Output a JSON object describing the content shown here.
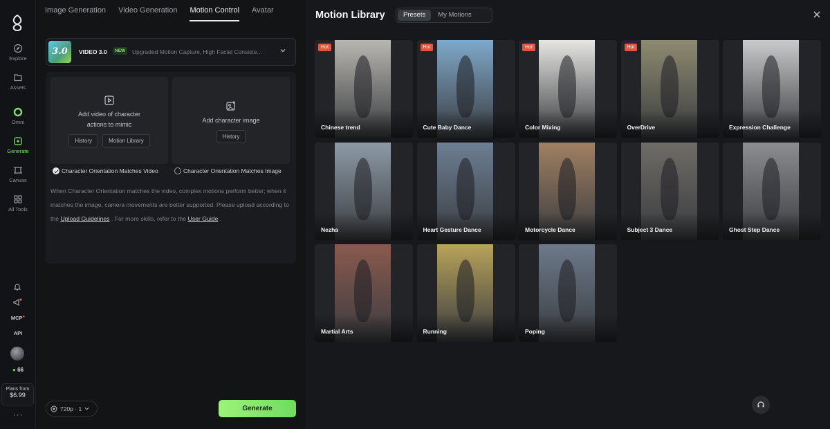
{
  "rail": {
    "items": [
      {
        "label": "Explore",
        "icon": "compass-icon"
      },
      {
        "label": "Assets",
        "icon": "folder-icon"
      },
      {
        "label": "Omni",
        "icon": "omni-icon"
      },
      {
        "label": "Generate",
        "icon": "generate-icon"
      },
      {
        "label": "Canvas",
        "icon": "canvas-icon"
      },
      {
        "label": "All Tools",
        "icon": "grid-icon"
      }
    ],
    "mcp_label": "MCP",
    "api_label": "API",
    "credits": "66",
    "plans_label": "Plans from",
    "plans_price": "$6.99",
    "more": "···"
  },
  "tabs": [
    "Image Generation",
    "Video Generation",
    "Motion Control",
    "Avatar"
  ],
  "active_tab": "Motion Control",
  "model": {
    "badge": "3.0",
    "name": "VIDEO 3.0",
    "tag": "NEW",
    "description": "Upgraded Motion Capture, High Facial Consiste..."
  },
  "upload": {
    "video_label_1": "Add video of character",
    "video_label_2": "actions to mimic",
    "history": "History",
    "motion_library": "Motion Library",
    "image_label": "Add character image",
    "image_history": "History"
  },
  "orientation": {
    "video": "Character Orientation Matches Video",
    "image": "Character Orientation Matches Image",
    "selected": "video"
  },
  "hint": {
    "p1": "When Character Orientation matches the video, complex motions perform better; when it matches the image, camera movements are better supported. Please upload according to the ",
    "link1": "Upload Guidelines",
    "p2": " . For more skills, refer to the ",
    "link2": "User Guide",
    "p3": " ."
  },
  "resolution": "720p · 1",
  "generate": "Generate",
  "library": {
    "title": "Motion Library",
    "segments": [
      "Presets",
      "My Motions"
    ],
    "active_segment": "Presets",
    "hot_label": "Hot",
    "items": [
      {
        "name": "Chinese trend",
        "hot": true,
        "color": "#b8b6b0"
      },
      {
        "name": "Cute Baby Dance",
        "hot": true,
        "color": "#7fa9c9"
      },
      {
        "name": "Color Mixing",
        "hot": true,
        "color": "#e6e6e3"
      },
      {
        "name": "OverDrive",
        "hot": true,
        "color": "#8e8a70"
      },
      {
        "name": "Expression Challenge",
        "hot": false,
        "color": "#c9cacb"
      },
      {
        "name": "Nezha",
        "hot": false,
        "color": "#8d9aa6"
      },
      {
        "name": "Heart Gesture Dance",
        "hot": false,
        "color": "#6d7f93"
      },
      {
        "name": "Motorcycle Dance",
        "hot": false,
        "color": "#a08062"
      },
      {
        "name": "Subject 3 Dance",
        "hot": false,
        "color": "#6f6c66"
      },
      {
        "name": "Ghost Step Dance",
        "hot": false,
        "color": "#8c8d90"
      },
      {
        "name": "Martial Arts",
        "hot": false,
        "color": "#8a5a4e"
      },
      {
        "name": "Running",
        "hot": false,
        "color": "#b7a35a"
      },
      {
        "name": "Poping",
        "hot": false,
        "color": "#6d7a8a"
      }
    ]
  }
}
